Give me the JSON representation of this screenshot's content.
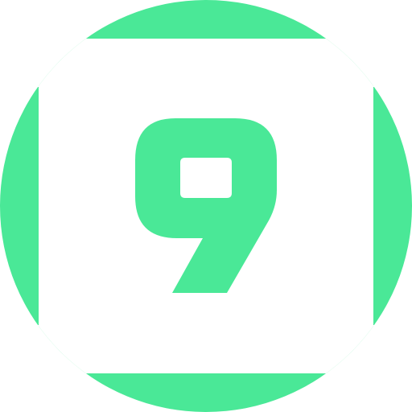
{
  "icon": {
    "name": "number-nine-icon",
    "glyph": "9",
    "colors": {
      "accent": "#4ae897",
      "background": "#ffffff"
    }
  }
}
